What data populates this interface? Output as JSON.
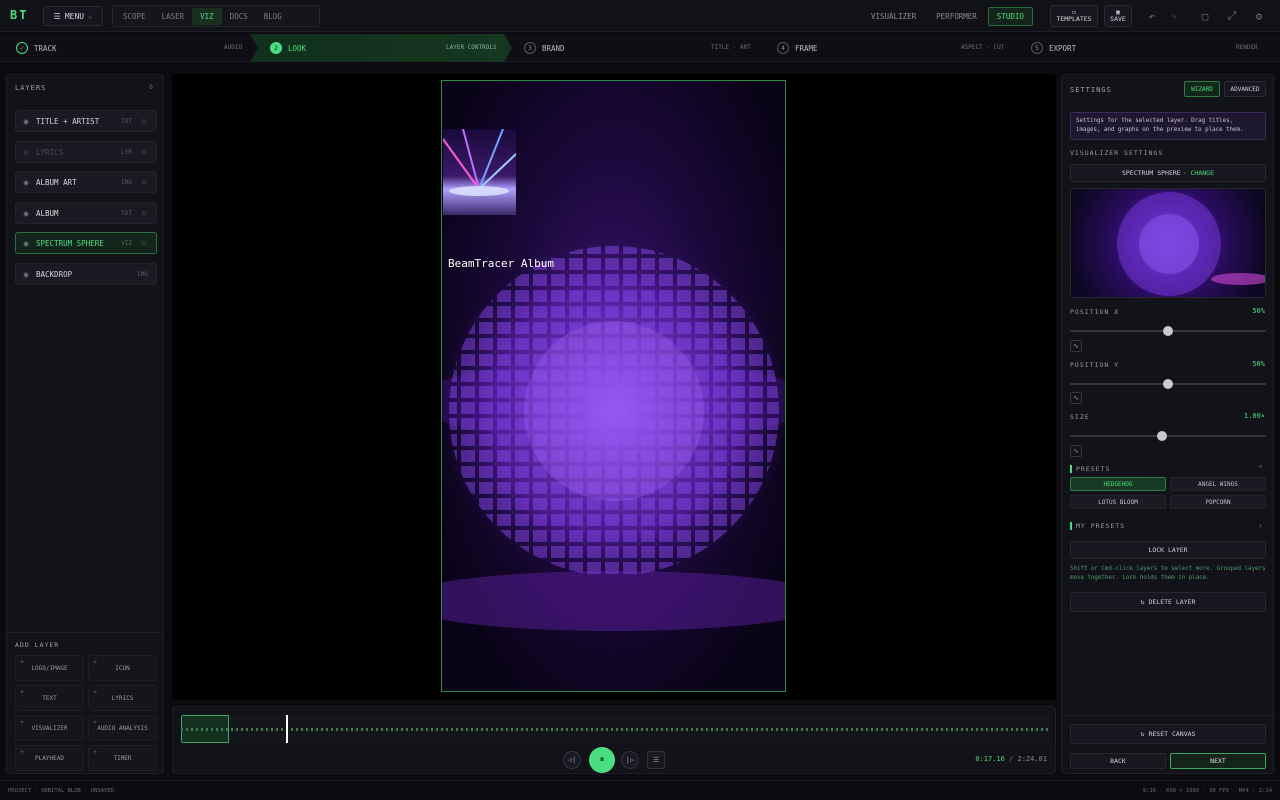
{
  "app": {
    "logo": "BT"
  },
  "topbar": {
    "menu_label": "MENU",
    "nav_tabs": [
      "SCOPE",
      "LASER",
      "VIZ",
      "DOCS",
      "BLOG"
    ],
    "active_nav": "VIZ",
    "modes": [
      "VISUALIZER",
      "PERFORMER",
      "STUDIO"
    ],
    "active_mode": "STUDIO",
    "templates_label": "TEMPLATES",
    "save_label": "SAVE"
  },
  "steps": [
    {
      "num": "✓",
      "title": "TRACK",
      "sub": "AUDIO"
    },
    {
      "num": "2",
      "title": "LOOK",
      "sub": "LAYER CONTROLS"
    },
    {
      "num": "3",
      "title": "BRAND",
      "sub": "TITLE · ART"
    },
    {
      "num": "4",
      "title": "FRAME",
      "sub": "ASPECT · CUT"
    },
    {
      "num": "5",
      "title": "EXPORT",
      "sub": "RENDER"
    }
  ],
  "layers_panel": {
    "title": "LAYERS",
    "count": "6",
    "layers": [
      {
        "name": "TITLE + ARTIST",
        "type": "TXT",
        "icon": "eye-icon"
      },
      {
        "name": "LYRICS",
        "type": "LYR",
        "icon": "eye-off-icon"
      },
      {
        "name": "ALBUM ART",
        "type": "IMG",
        "icon": "eye-icon"
      },
      {
        "name": "ALBUM",
        "type": "TXT",
        "icon": "eye-icon"
      },
      {
        "name": "SPECTRUM SPHERE",
        "type": "VIZ",
        "icon": "eye-icon"
      },
      {
        "name": "BACKDROP",
        "type": "IMG",
        "icon": "eye-icon"
      }
    ],
    "add_title": "ADD LAYER",
    "add_buttons": [
      "LOGO/IMAGE",
      "ICON",
      "TEXT",
      "LYRICS",
      "VISUALIZER",
      "AUDIO ANALYSIS",
      "PLAYHEAD",
      "TIMER"
    ]
  },
  "canvas": {
    "album_title": "BeamTracer Album"
  },
  "timeline": {
    "current": "0:17.16",
    "separator": "/",
    "total": "2:24.01"
  },
  "settings": {
    "title": "SETTINGS",
    "tab_wizard": "WIZARD",
    "tab_advanced": "ADVANCED",
    "hint": "Settings for the selected layer. Drag titles, images, and graphs on the preview to place them.",
    "section_viz": "VISUALIZER SETTINGS",
    "viz_name": "SPECTRUM SPHERE",
    "viz_change": "· CHANGE",
    "position_x_label": "POSITION X",
    "position_x_value": "50%",
    "position_x_level": 0.5,
    "position_y_label": "POSITION Y",
    "position_y_value": "50%",
    "position_y_level": 0.5,
    "size_label": "SIZE",
    "size_value": "1.00×",
    "size_level": 0.47,
    "presets_title": "PRESETS",
    "presets": [
      "HEDGEHOG",
      "ANGEL WINGS",
      "LOTUS BLOOM",
      "POPCORN"
    ],
    "active_preset": "HEDGEHOG",
    "my_presets_title": "MY PRESETS",
    "lock_label": "LOCK LAYER",
    "group_hint": "Shift or Cmd-click layers to select more. Grouped layers move together. Lock holds them in place.",
    "delete_label": "DELETE LAYER",
    "reset_label": "RESET CANVAS",
    "back_label": "BACK",
    "next_label": "NEXT"
  },
  "status": {
    "left": "PROJECT · ORBITAL BLOB · UNSAVED",
    "right": "9:16 · 608 × 1080 · 30 FPS · MP4 · 2:24"
  },
  "colors": {
    "accent": "#4ade80",
    "bg": "#0b0b10",
    "panel": "#121219",
    "purple": "#7c3aed"
  }
}
